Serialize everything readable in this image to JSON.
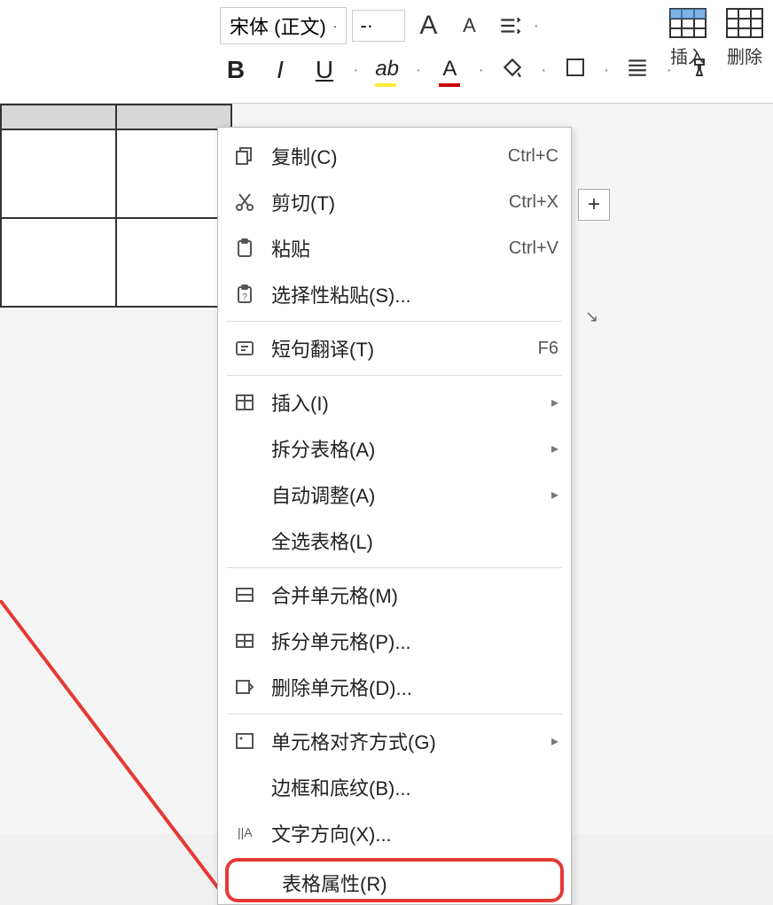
{
  "toolbar": {
    "font_name": "宋体 (正文)",
    "font_size": "-",
    "bold": "B",
    "italic": "I",
    "underline": "U",
    "increase_font": "A",
    "decrease_font": "A",
    "highlight": "ab",
    "font_color": "A",
    "insert_label": "插入",
    "delete_label": "删除"
  },
  "context_menu": {
    "items": [
      {
        "icon": "copy",
        "label": "复制(C)",
        "shortcut": "Ctrl+C"
      },
      {
        "icon": "cut",
        "label": "剪切(T)",
        "shortcut": "Ctrl+X"
      },
      {
        "icon": "paste",
        "label": "粘贴",
        "shortcut": "Ctrl+V"
      },
      {
        "icon": "paste-special",
        "label": "选择性粘贴(S)...",
        "shortcut": ""
      },
      {
        "icon": "translate",
        "label": "短句翻译(T)",
        "shortcut": "F6"
      },
      {
        "icon": "insert",
        "label": "插入(I)",
        "submenu": true
      },
      {
        "icon": "",
        "label": "拆分表格(A)",
        "submenu": true
      },
      {
        "icon": "",
        "label": "自动调整(A)",
        "submenu": true
      },
      {
        "icon": "",
        "label": "全选表格(L)",
        "shortcut": ""
      },
      {
        "icon": "merge",
        "label": "合并单元格(M)",
        "shortcut": ""
      },
      {
        "icon": "split",
        "label": "拆分单元格(P)...",
        "shortcut": ""
      },
      {
        "icon": "delete",
        "label": "删除单元格(D)...",
        "shortcut": ""
      },
      {
        "icon": "align",
        "label": "单元格对齐方式(G)",
        "submenu": true
      },
      {
        "icon": "",
        "label": "边框和底纹(B)...",
        "shortcut": ""
      },
      {
        "icon": "text-dir",
        "label": "文字方向(X)...",
        "shortcut": ""
      },
      {
        "icon": "",
        "label": "表格属性(R)",
        "highlighted": true
      }
    ]
  },
  "plus_button": "+"
}
